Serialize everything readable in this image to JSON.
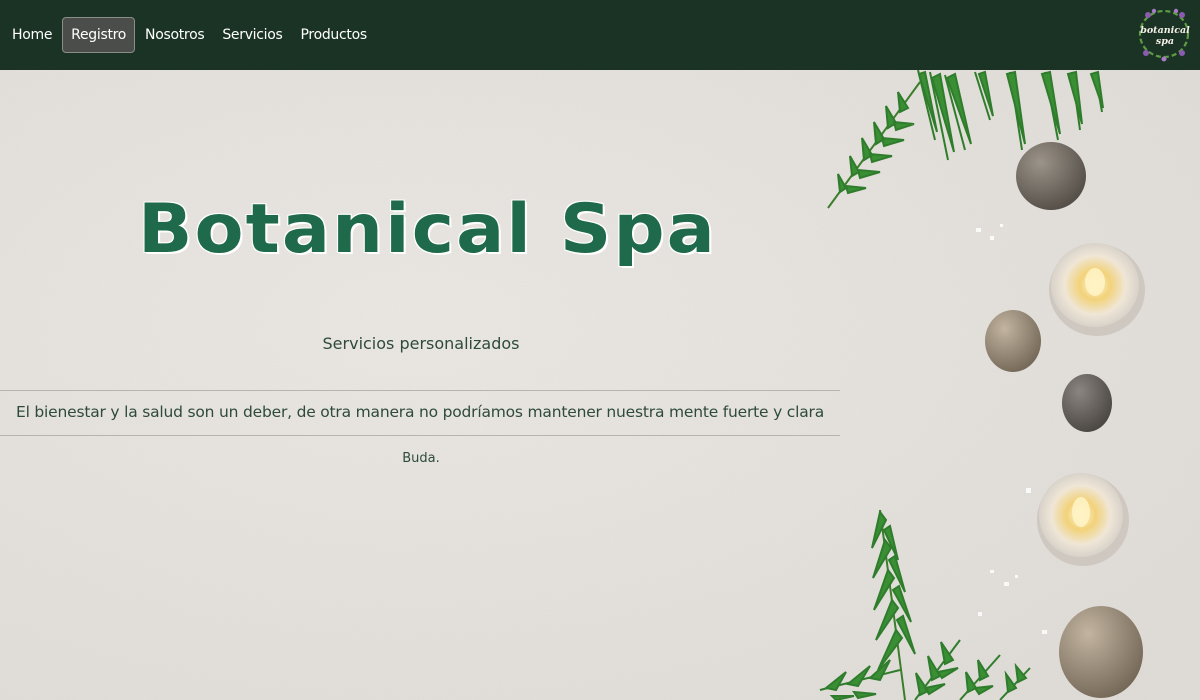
{
  "nav": {
    "items": [
      {
        "label": "Home"
      },
      {
        "label": "Registro"
      },
      {
        "label": "Nosotros"
      },
      {
        "label": "Servicios"
      },
      {
        "label": "Productos"
      }
    ],
    "active_index": 1,
    "logo_text": "botanical spa"
  },
  "hero": {
    "title": "Botanical Spa",
    "subtitle": "Servicios personalizados",
    "quote": "El bienestar y la salud son un deber, de otra manera no podríamos mantener nuestra mente fuerte y clara",
    "author": "Buda."
  },
  "colors": {
    "navbar": "#1b3324",
    "title": "#1e6a4a",
    "text": "#2e4a3a",
    "background": "#e9e6e2"
  },
  "icons": [
    "logo-wreath-icon",
    "fern-leaf",
    "spa-stone",
    "tealight-candle"
  ]
}
